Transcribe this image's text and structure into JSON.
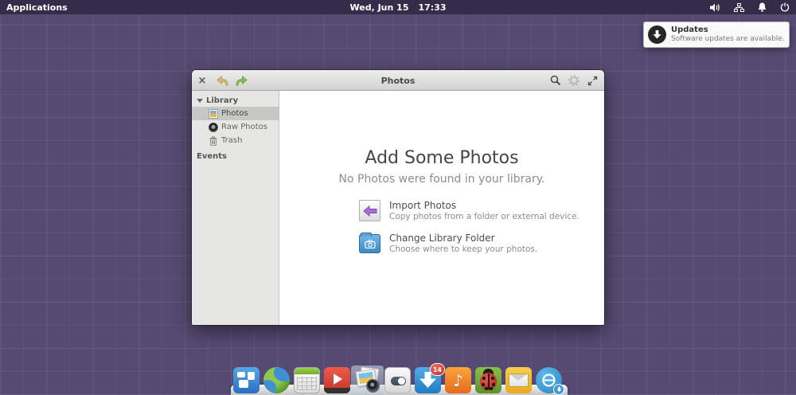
{
  "panel": {
    "applications_label": "Applications",
    "date": "Wed, Jun 15",
    "time": "17:33",
    "indicator_icons": [
      "volume-icon",
      "network-icon",
      "notifications-bell-icon",
      "power-icon"
    ]
  },
  "notification": {
    "title": "Updates",
    "body": "Software updates are available.",
    "icon": "software-update-download-icon"
  },
  "window": {
    "title": "Photos",
    "titlebar": {
      "close_glyph": "×",
      "icons": [
        "undo-icon",
        "redo-icon",
        "search-icon",
        "gear-icon",
        "fullscreen-icon"
      ]
    },
    "sidebar": {
      "library_header": "Library",
      "items": [
        {
          "label": "Photos",
          "icon": "photos-mini-icon",
          "selected": true
        },
        {
          "label": "Raw Photos",
          "icon": "raw-photos-mini-icon",
          "selected": false
        },
        {
          "label": "Trash",
          "icon": "trash-mini-icon",
          "selected": false
        }
      ],
      "events_header": "Events"
    },
    "main": {
      "title": "Add Some Photos",
      "subtitle": "No Photos were found in your library.",
      "actions": [
        {
          "label": "Import Photos",
          "description": "Copy photos from a folder or external device.",
          "icon": "import-photos-icon"
        },
        {
          "label": "Change Library Folder",
          "description": "Choose where to keep your photos.",
          "icon": "library-folder-icon"
        }
      ]
    }
  },
  "dock": {
    "update_badge": "14",
    "music_glyph": "♪",
    "items": [
      "multitasking-view",
      "web-browser",
      "calendar",
      "videos",
      "photos",
      "system-settings",
      "appcenter-updates",
      "music",
      "bug-reporter",
      "mail",
      "os-installer"
    ]
  },
  "colors": {
    "desktop": "#564a72",
    "panel": "#2e2842",
    "titlebar_top": "#ededed",
    "titlebar_bottom": "#d2d2d2",
    "sidebar_bg": "#e6e6e4",
    "selection_gray": "#c7c7c5",
    "accent_blue": "#3d9ad6",
    "badge_red": "#c62b20",
    "music_orange": "#e8681d",
    "mail_yellow": "#eaa91f"
  }
}
